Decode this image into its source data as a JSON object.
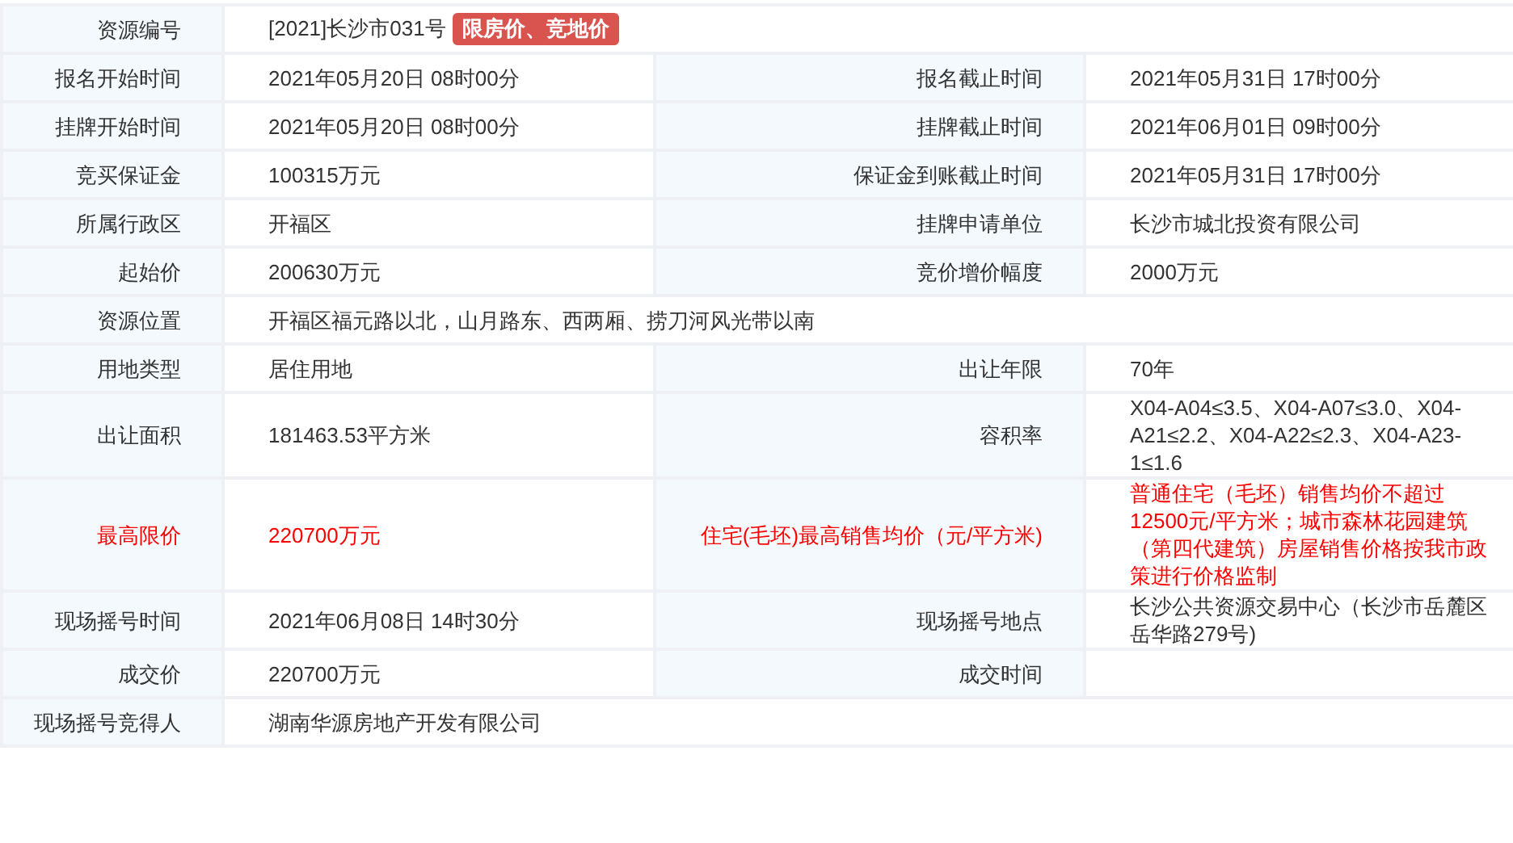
{
  "rows": [
    {
      "fields": [
        {
          "label": "资源编号",
          "value": "[2021]长沙市031号",
          "tag": "限房价、竞地价",
          "emphasis": false
        }
      ]
    },
    {
      "fields": [
        {
          "label": "报名开始时间",
          "value": "2021年05月20日 08时00分",
          "emphasis": false
        },
        {
          "label": "报名截止时间",
          "value": "2021年05月31日 17时00分",
          "emphasis": false
        }
      ]
    },
    {
      "fields": [
        {
          "label": "挂牌开始时间",
          "value": "2021年05月20日 08时00分",
          "emphasis": false
        },
        {
          "label": "挂牌截止时间",
          "value": "2021年06月01日 09时00分",
          "emphasis": false
        }
      ]
    },
    {
      "fields": [
        {
          "label": "竞买保证金",
          "value": "100315万元",
          "emphasis": false
        },
        {
          "label": "保证金到账截止时间",
          "value": "2021年05月31日 17时00分",
          "emphasis": false
        }
      ]
    },
    {
      "fields": [
        {
          "label": "所属行政区",
          "value": "开福区",
          "emphasis": false
        },
        {
          "label": "挂牌申请单位",
          "value": "长沙市城北投资有限公司",
          "emphasis": false
        }
      ]
    },
    {
      "fields": [
        {
          "label": "起始价",
          "value": "200630万元",
          "emphasis": false
        },
        {
          "label": "竞价增价幅度",
          "value": "2000万元",
          "emphasis": false
        }
      ]
    },
    {
      "fields": [
        {
          "label": "资源位置",
          "value": "开福区福元路以北，山月路东、西两厢、捞刀河风光带以南",
          "emphasis": false
        }
      ]
    },
    {
      "fields": [
        {
          "label": "用地类型",
          "value": "居住用地",
          "emphasis": false
        },
        {
          "label": "出让年限",
          "value": "70年",
          "emphasis": false
        }
      ]
    },
    {
      "fields": [
        {
          "label": "出让面积",
          "value": "181463.53平方米",
          "emphasis": false
        },
        {
          "label": "容积率",
          "value": "X04-A04≤3.5、X04-A07≤3.0、X04-A21≤2.2、X04-A22≤2.3、X04-A23-1≤1.6",
          "emphasis": false
        }
      ]
    },
    {
      "fields": [
        {
          "label": "最高限价",
          "value": "220700万元",
          "emphasis": true
        },
        {
          "label": "住宅(毛坯)最高销售均价（元/平方米)",
          "value": "普通住宅（毛坯）销售均价不超过12500元/平方米；城市森林花园建筑（第四代建筑）房屋销售价格按我市政策进行价格监制",
          "emphasis": true
        }
      ]
    },
    {
      "fields": [
        {
          "label": "现场摇号时间",
          "value": "2021年06月08日 14时30分",
          "emphasis": false
        },
        {
          "label": "现场摇号地点",
          "value": "长沙公共资源交易中心（长沙市岳麓区岳华路279号)",
          "emphasis": false
        }
      ]
    },
    {
      "fields": [
        {
          "label": "成交价",
          "value": "220700万元",
          "emphasis": false
        },
        {
          "label": "成交时间",
          "emphasis": false
        }
      ]
    },
    {
      "fields": [
        {
          "label": "现场摇号竞得人",
          "value": "湖南华源房地产开发有限公司",
          "emphasis": false
        }
      ]
    }
  ]
}
